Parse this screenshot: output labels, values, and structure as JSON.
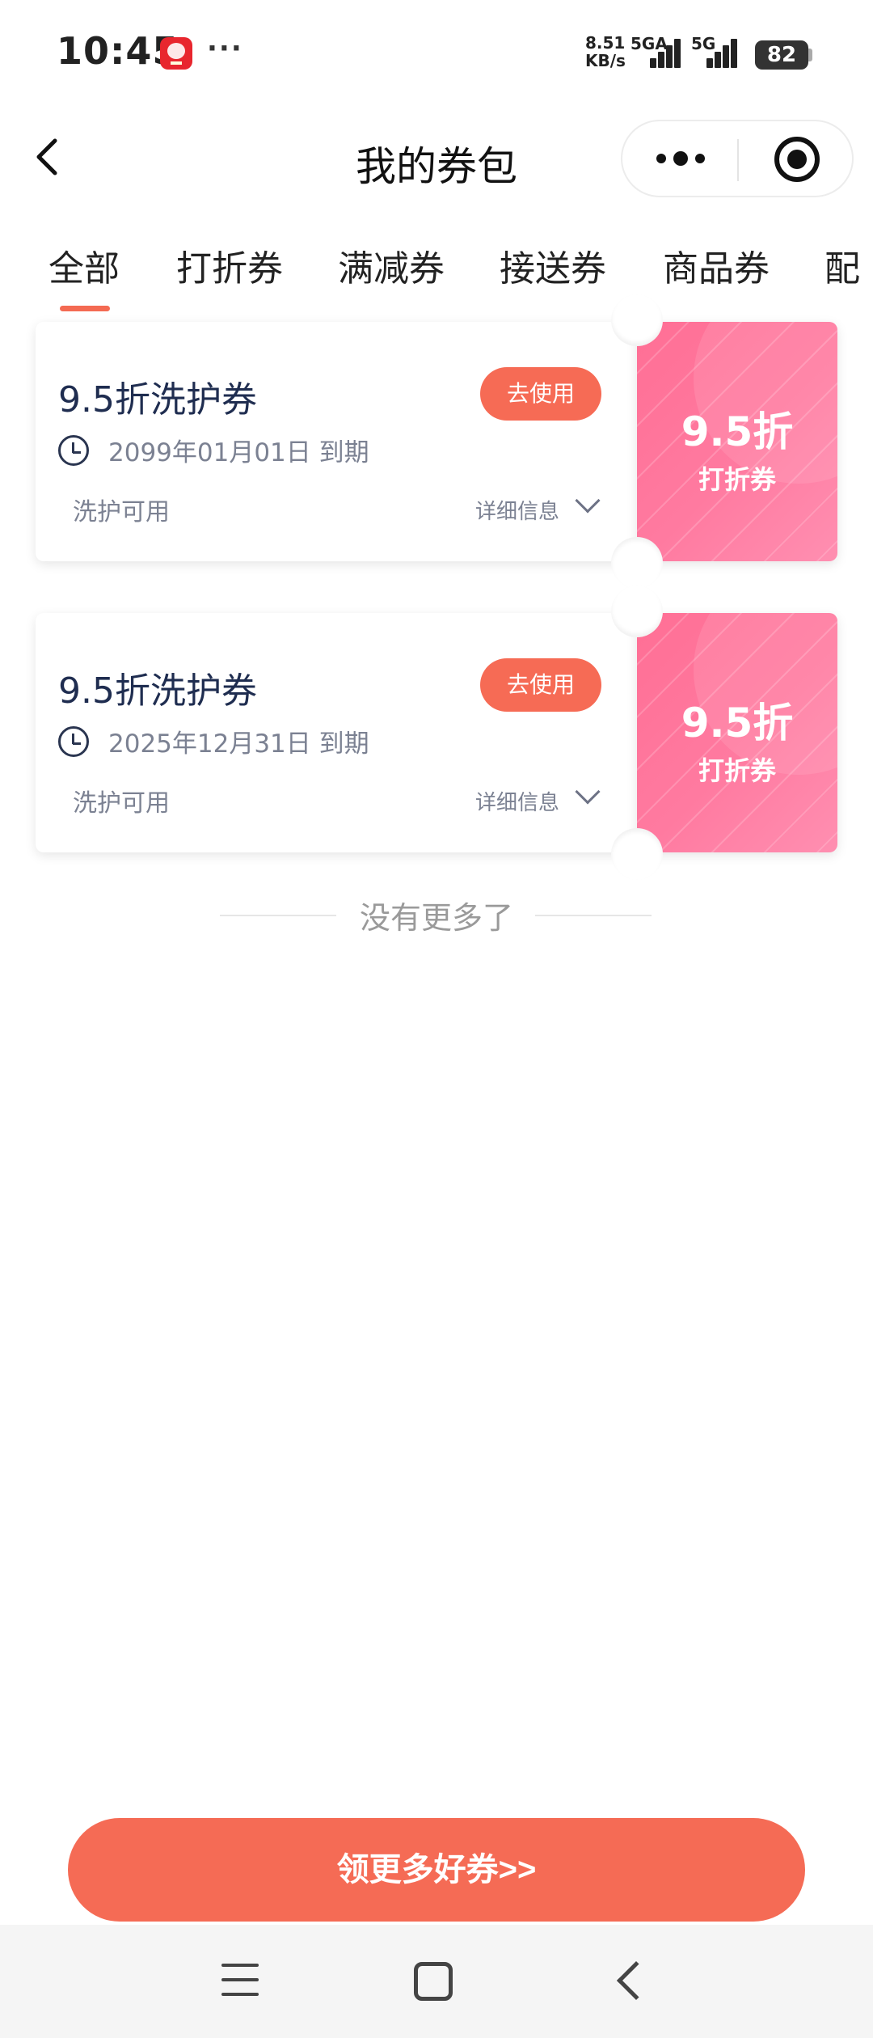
{
  "status_bar": {
    "time": "10:45",
    "dots": "···",
    "net_speed_value": "8.51",
    "net_speed_unit": "KB/s",
    "network_type_1": "5GA",
    "network_type_2": "5G",
    "battery": "82"
  },
  "nav": {
    "title": "我的券包",
    "back_icon": "chevron-left-icon",
    "more_icon": "more-dots-icon",
    "close_icon": "target-circle-icon"
  },
  "tabs": [
    {
      "label": "全部",
      "active": true
    },
    {
      "label": "打折券"
    },
    {
      "label": "满减券"
    },
    {
      "label": "接送券"
    },
    {
      "label": "商品券"
    },
    {
      "label": "配"
    }
  ],
  "coupons": [
    {
      "title": "9.5折洗护券",
      "use_label": "去使用",
      "expiry": "2099年01月01日 到期",
      "scope": "洗护可用",
      "detail_label": "详细信息",
      "side_value": "9.5折",
      "side_type": "打折券"
    },
    {
      "title": "9.5折洗护券",
      "use_label": "去使用",
      "expiry": "2025年12月31日 到期",
      "scope": "洗护可用",
      "detail_label": "详细信息",
      "side_value": "9.5折",
      "side_type": "打折券"
    }
  ],
  "no_more": "没有更多了",
  "cta_label": "领更多好券>>",
  "colors": {
    "accent": "#f56b55",
    "coupon_pink": "#ff7aa0",
    "title_navy": "#1f2d50"
  }
}
